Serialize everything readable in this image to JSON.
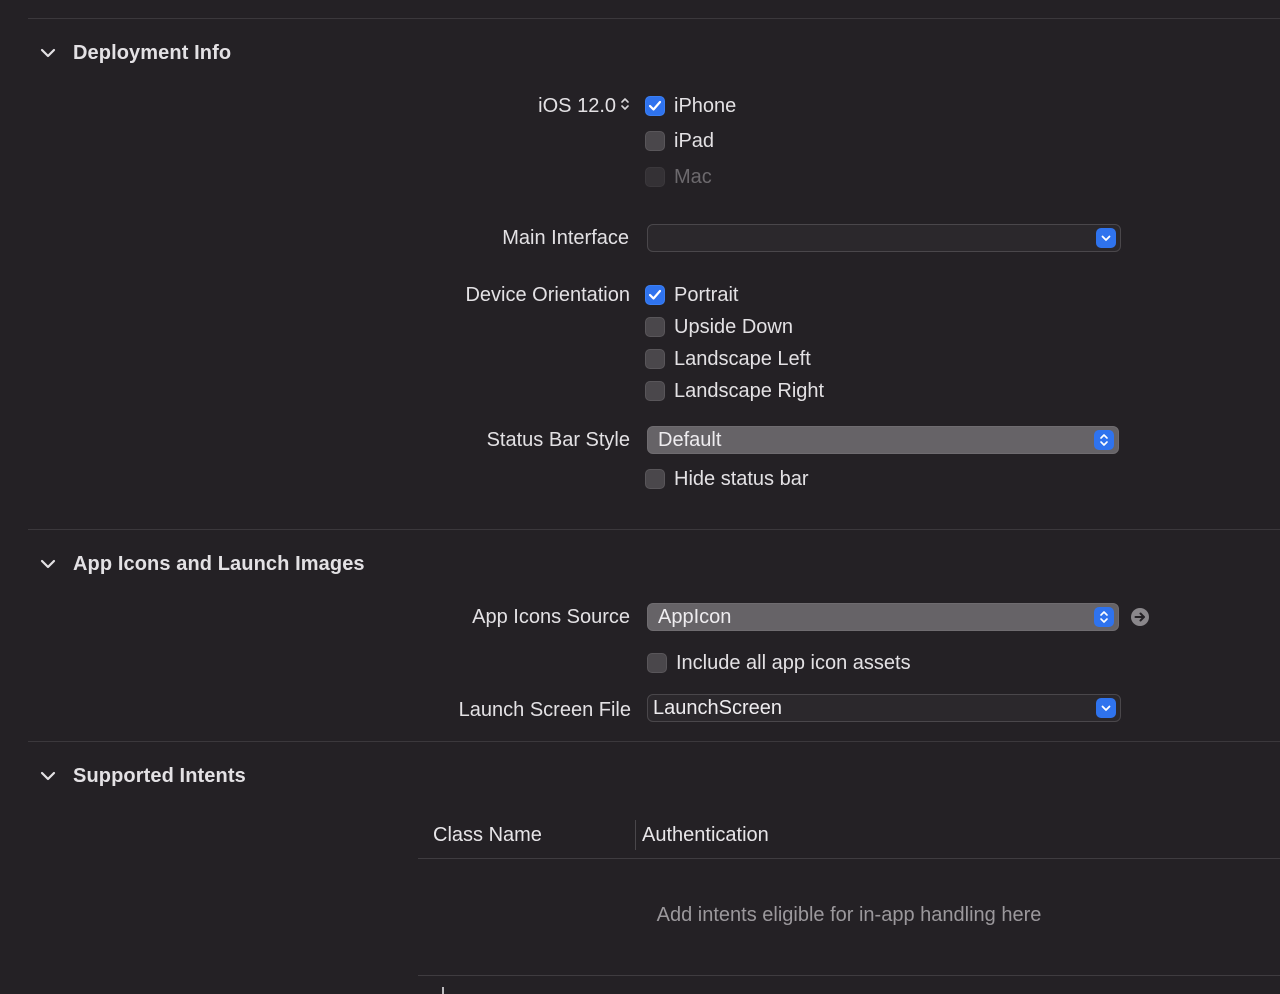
{
  "deployment_info": {
    "title": "Deployment Info",
    "ios_version": "iOS 12.0",
    "devices": [
      {
        "label": "iPhone",
        "checked": true,
        "enabled": true
      },
      {
        "label": "iPad",
        "checked": false,
        "enabled": true
      },
      {
        "label": "Mac",
        "checked": false,
        "enabled": false
      }
    ],
    "main_interface_label": "Main Interface",
    "main_interface_value": "",
    "device_orientation_label": "Device Orientation",
    "orientations": [
      {
        "label": "Portrait",
        "checked": true
      },
      {
        "label": "Upside Down",
        "checked": false
      },
      {
        "label": "Landscape Left",
        "checked": false
      },
      {
        "label": "Landscape Right",
        "checked": false
      }
    ],
    "status_bar_style_label": "Status Bar Style",
    "status_bar_style_value": "Default",
    "hide_status_bar_label": "Hide status bar",
    "hide_status_bar_checked": false
  },
  "app_icons": {
    "title": "App Icons and Launch Images",
    "app_icons_source_label": "App Icons Source",
    "app_icons_source_value": "AppIcon",
    "include_all_label": "Include all app icon assets",
    "include_all_checked": false,
    "launch_screen_label": "Launch Screen File",
    "launch_screen_value": "LaunchScreen"
  },
  "supported_intents": {
    "title": "Supported Intents",
    "columns": [
      "Class Name",
      "Authentication"
    ],
    "empty_message": "Add intents eligible for in-app handling here"
  },
  "colors": {
    "background": "#242125",
    "accent": "#2f73ee",
    "text": "#e3e1e4",
    "disabled_text": "#6c696d",
    "placeholder_text": "#9b989c"
  }
}
